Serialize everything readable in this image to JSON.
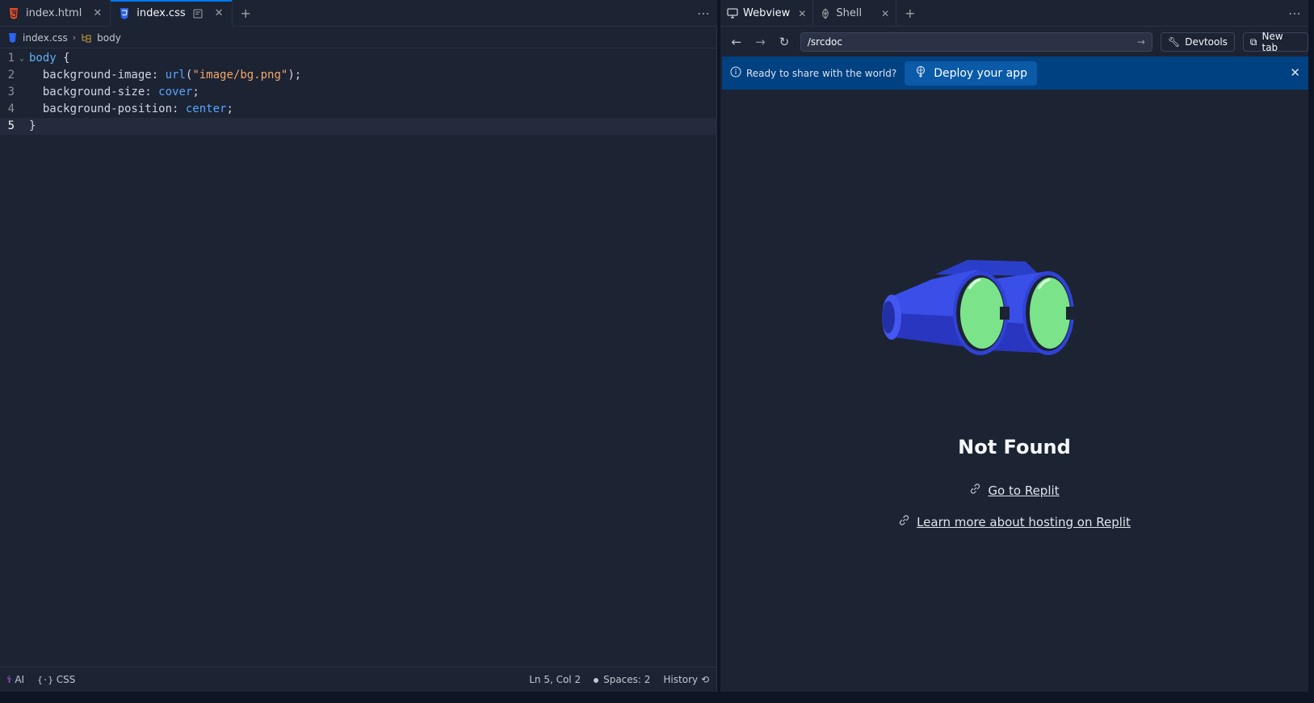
{
  "editor": {
    "tabs": [
      {
        "label": "index.html",
        "icon": "html5-icon",
        "active": false
      },
      {
        "label": "index.css",
        "icon": "css3-icon",
        "active": true
      }
    ],
    "breadcrumb": {
      "file": "index.css",
      "symbol": "body"
    },
    "code_lines": [
      {
        "num": "1",
        "text": "body {"
      },
      {
        "num": "2",
        "text": "  background-image: url(\"image/bg.png\");"
      },
      {
        "num": "3",
        "text": "  background-size: cover;"
      },
      {
        "num": "4",
        "text": "  background-position: center;"
      },
      {
        "num": "5",
        "text": "}"
      }
    ],
    "status": {
      "ai": "AI",
      "language": "CSS",
      "position": "Ln 5, Col 2",
      "spaces": "Spaces: 2",
      "history": "History"
    }
  },
  "webview": {
    "tabs": [
      {
        "label": "Webview",
        "icon": "monitor-icon",
        "active": true
      },
      {
        "label": "Shell",
        "icon": "shell-icon",
        "active": false
      }
    ],
    "url": "/srcdoc",
    "devtools_label": "Devtools",
    "newtab_label": "New tab",
    "banner": {
      "text": "Ready to share with the world?",
      "button": "Deploy your app"
    },
    "page": {
      "title": "Not Found",
      "link1": "Go to Replit",
      "link2": "Learn more about hosting on Replit"
    }
  },
  "colors": {
    "background": "#1c2333",
    "accent": "#0079f2",
    "banner": "#004182"
  }
}
